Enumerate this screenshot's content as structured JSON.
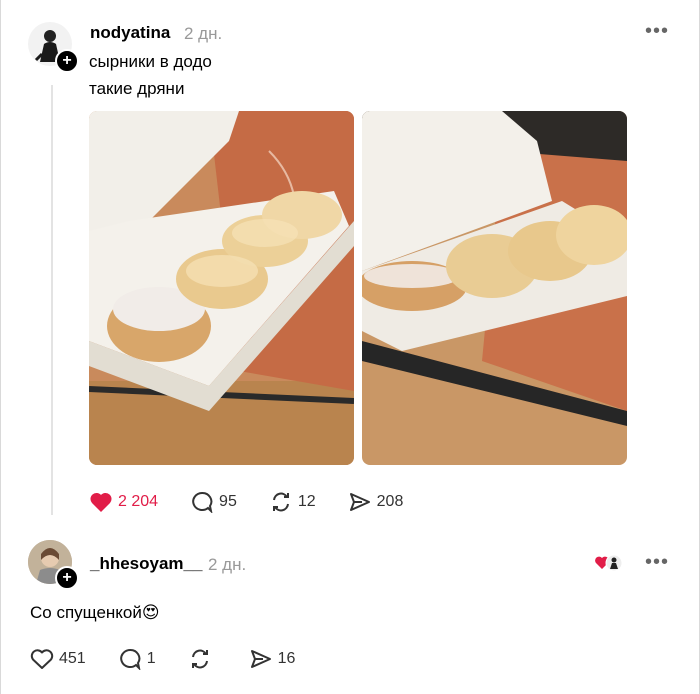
{
  "post": {
    "username": "nodyatina",
    "time": "2 дн.",
    "lines": [
      "сырники в додо",
      "такие дряни"
    ],
    "stats": {
      "likes": "2 204",
      "comments": "95",
      "reposts": "12",
      "shares": "208"
    },
    "photos": [
      "photo-1",
      "photo-2"
    ]
  },
  "comment": {
    "username": "_hhesoyam__",
    "time": "2 дн.",
    "text": "Со спущенкой",
    "emoji": "😍",
    "stats": {
      "likes": "451",
      "comments": "1",
      "reposts": "",
      "shares": "16"
    }
  },
  "colors": {
    "like": "#e11d48",
    "muted": "#999999"
  }
}
